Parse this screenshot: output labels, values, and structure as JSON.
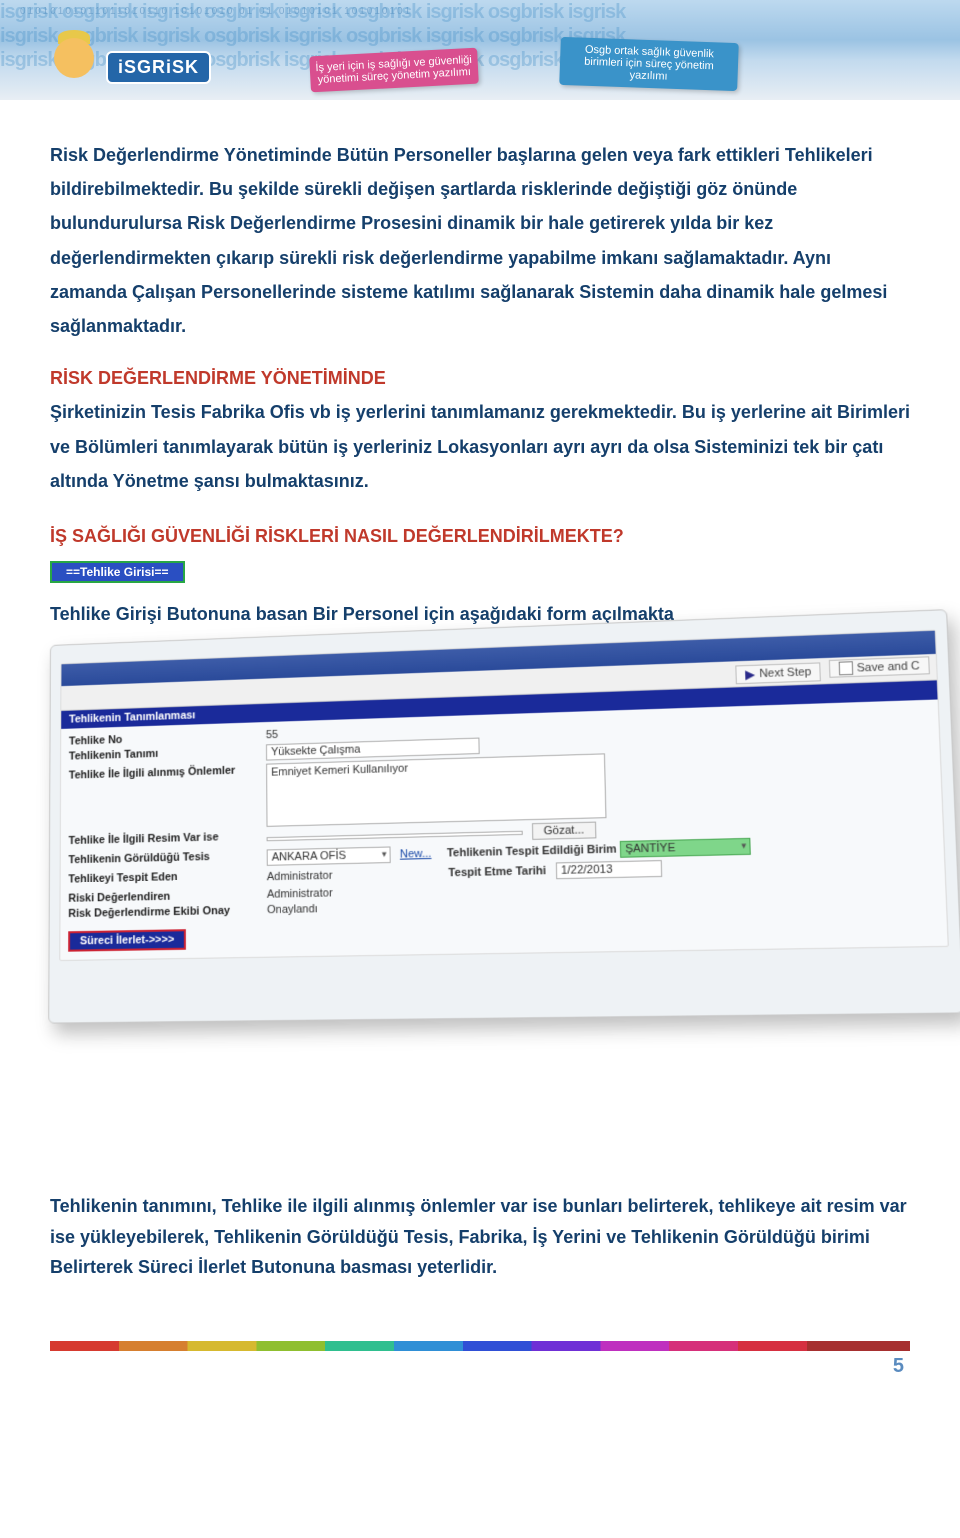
{
  "banner": {
    "brand": "iSGRiSK",
    "bg_repeat": "isgrisk osgbrisk isgrisk osgbrisk isgrisk osgbrisk isgrisk osgbrisk isgrisk",
    "binary": "01010101011011010110   10101010    01  01  01010101   101010101",
    "pink_bubble": "İş yeri için iş sağlığı ve güvenliği yönetimi süreç yönetim yazılımı",
    "blue_bubble": "Osgb ortak sağlık güvenlik birimleri için süreç yönetim yazılımı"
  },
  "para1": "Risk Değerlendirme Yönetiminde Bütün Personeller başlarına gelen veya fark ettikleri Tehlikeleri bildirebilmektedir. Bu şekilde sürekli değişen şartlarda risklerinde değiştiği göz önünde bulundurulursa Risk Değerlendirme Prosesini dinamik bir hale getirerek yılda bir kez değerlendirmekten çıkarıp sürekli risk değerlendirme yapabilme imkanı sağlamaktadır. Aynı zamanda Çalışan Personellerinde sisteme katılımı sağlanarak Sistemin daha dinamik hale gelmesi sağlanmaktadır.",
  "red_heading_inline": "RİSK DEĞERLENDİRME YÖNETİMİNDE",
  "para2": "Şirketinizin Tesis Fabrika Ofis vb iş yerlerini tanımlamanız gerekmektedir. Bu iş yerlerine ait Birimleri ve Bölümleri tanımlayarak bütün iş yerleriniz Lokasyonları ayrı ayrı da olsa Sisteminizi tek bir çatı altında Yönetme şansı bulmaktasınız.",
  "section_q": "İŞ SAĞLIĞI GÜVENLİĞİ RİSKLERİ NASIL DEĞERLENDİRİLMEKTE?",
  "tehlike_button": "==Tehlike Girisi==",
  "tehlike_intro": "Tehlike Girişi Butonuna basan Bir Personel için aşağıdaki form açılmakta",
  "form": {
    "topbar": "",
    "toolbar": {
      "next": "Next Step",
      "save": "Save and C"
    },
    "section_title": "Tehlikenin Tanımlanması",
    "labels": {
      "no": "Tehlike No",
      "tanim": "Tehlikenin Tanımı",
      "onlem": "Tehlike İle İlgili alınmış Önlemler",
      "resim": "Tehlike İle İlgili Resim Var ise",
      "tesis": "Tehlikenin Görüldüğü Tesis",
      "tespit_eden": "Tehlikeyi Tespit Eden",
      "degerlendiren": "Riski Değerlendiren",
      "ekip_onay": "Risk Değerlendirme Ekibi Onay",
      "birim": "Tehlikenin Tespit Edildiği Birim",
      "tarih": "Tespit Etme Tarihi"
    },
    "values": {
      "no": "55",
      "tanim": "Yüksekte Çalışma",
      "onlem": "Emniyet Kemeri Kullanılıyor",
      "tesis": "ANKARA OFİS",
      "tespit_eden": "Administrator",
      "degerlendiren": "Administrator",
      "ekip_onay": "Onaylandı",
      "birim": "ŞANTİYE",
      "tarih": "1/22/2013",
      "gozat": "Gözat...",
      "new": "New..."
    },
    "ilerlet": "Süreci İlerlet->>>>"
  },
  "closing": "Tehlikenin tanımını, Tehlike ile ilgili alınmış önlemler var ise bunları belirterek, tehlikeye ait resim var ise yükleyebilerek, Tehlikenin Görüldüğü Tesis, Fabrika, İş Yerini ve Tehlikenin Görüldüğü birimi Belirterek Süreci İlerlet Butonuna basması yeterlidir.",
  "page_number": "5"
}
